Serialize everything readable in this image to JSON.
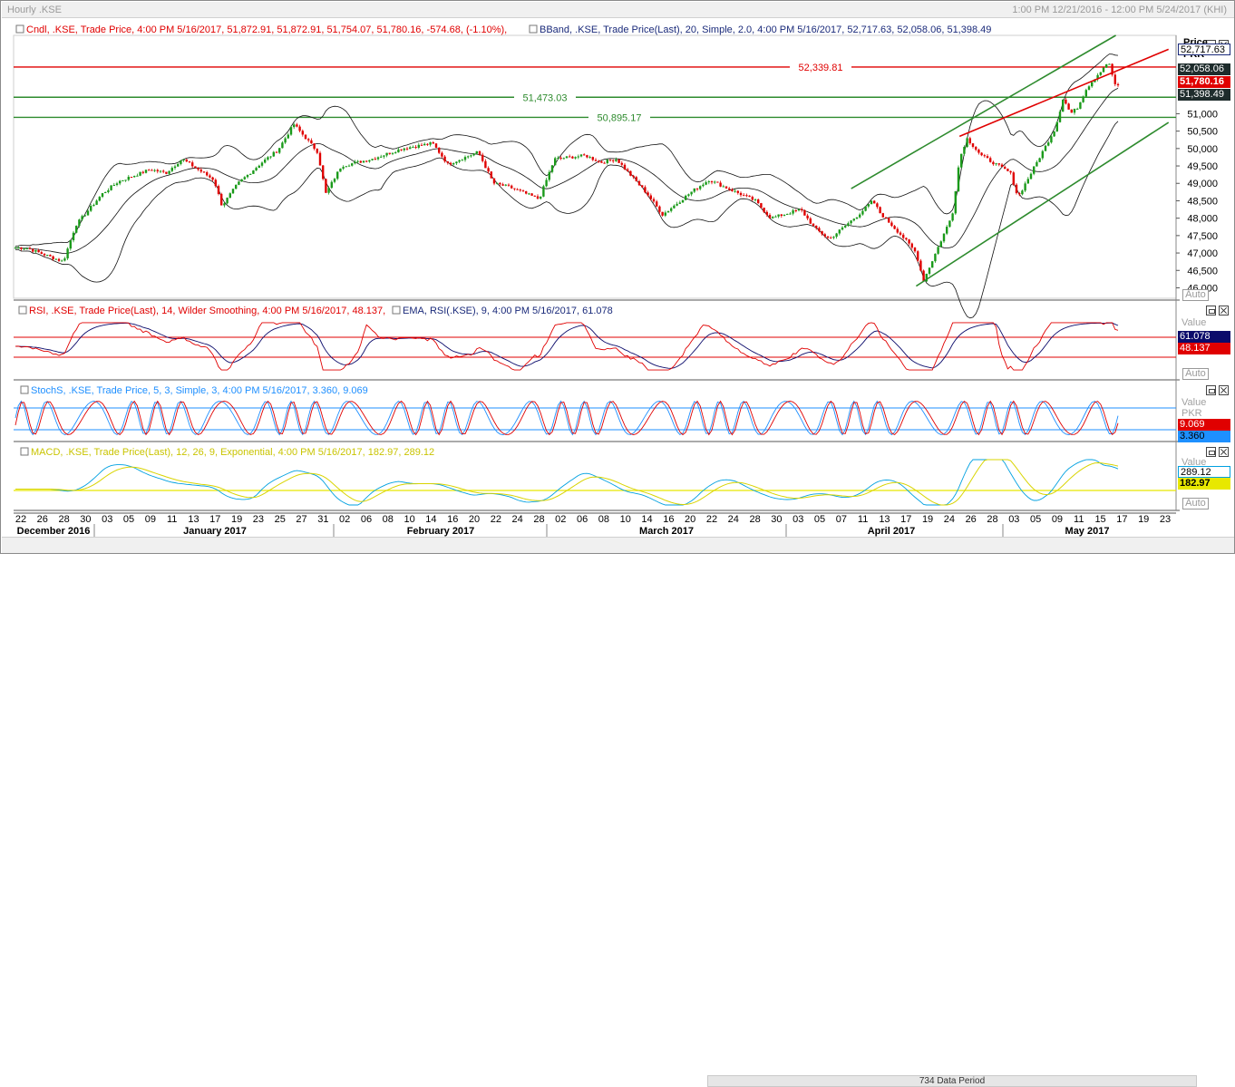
{
  "window": {
    "title": "Hourly .KSE",
    "range": "1:00 PM 12/21/2016 - 12:00 PM 5/24/2017 (KHI)"
  },
  "panes": {
    "price": {
      "legend_candle": "Cndl, .KSE, Trade Price, 4:00 PM 5/16/2017, 51,872.91, 51,872.91, 51,754.07, 51,780.16, -574.68, (-1.10%),",
      "legend_bband": "BBand, .KSE, Trade Price(Last), 20, Simple, 2.0, 4:00 PM 5/16/2017, 52,717.63, 52,058.06, 51,398.49",
      "axis_title": "Price",
      "axis_unit": "PKR",
      "tags": [
        "52,717.63",
        "52,058.06",
        "51,780.16",
        "51,398.49"
      ],
      "auto_label": "Auto"
    },
    "rsi": {
      "legend_rsi": "RSI, .KSE, Trade Price(Last), 14, Wilder Smoothing, 4:00 PM 5/16/2017, 48.137,",
      "legend_ema": "EMA, RSI(.KSE), 9, 4:00 PM 5/16/2017, 61.078",
      "axis_title": "Value",
      "tags": [
        "61.078",
        "48.137"
      ],
      "auto_label": "Auto"
    },
    "stoch": {
      "legend": "StochS, .KSE, Trade Price, 5, 3, Simple, 3, 4:00 PM 5/16/2017, 3.360, 9.069",
      "axis_title": "Value",
      "axis_unit": "PKR",
      "tags": [
        "9.069",
        "3.360"
      ]
    },
    "macd": {
      "legend": "MACD, .KSE, Trade Price(Last), 12, 26, 9, Exponential, 4:00 PM 5/16/2017, 182.97, 289.12",
      "axis_title": "Value",
      "tags": [
        "289.12",
        "182.97"
      ],
      "auto_label": "Auto"
    }
  },
  "statusbar": {
    "period": "734 Data Period"
  },
  "chart_data": {
    "type": "candlestick",
    "symbol": ".KSE",
    "interval": "Hourly",
    "y_ticks": [
      "46,000",
      "46,500",
      "47,000",
      "47,500",
      "48,000",
      "48,500",
      "49,000",
      "49,500",
      "50,000",
      "50,500",
      "51,000"
    ],
    "ylim": [
      45700,
      53250
    ],
    "horizontal_levels": [
      {
        "value": 52339.81,
        "label": "52,339.81",
        "color": "#e00000"
      },
      {
        "value": 51473.03,
        "label": "51,473.03",
        "color": "#2e8b2e"
      },
      {
        "value": 50895.17,
        "label": "50,895.17",
        "color": "#2e8b2e"
      }
    ],
    "x_day_ticks": [
      "22",
      "26",
      "28",
      "30",
      "03",
      "05",
      "09",
      "11",
      "13",
      "17",
      "19",
      "23",
      "25",
      "27",
      "31",
      "02",
      "06",
      "08",
      "10",
      "14",
      "16",
      "20",
      "22",
      "24",
      "28",
      "02",
      "06",
      "08",
      "10",
      "14",
      "16",
      "20",
      "22",
      "24",
      "28",
      "30",
      "03",
      "05",
      "07",
      "11",
      "13",
      "17",
      "19",
      "24",
      "26",
      "28",
      "03",
      "05",
      "09",
      "11",
      "15",
      "17",
      "19",
      "23"
    ],
    "x_month_labels": [
      "December 2016",
      "January 2017",
      "February 2017",
      "March 2017",
      "April 2017",
      "May 2017"
    ],
    "close_path": [
      [
        "12/22/2016",
        47150
      ],
      [
        "12/28/2016",
        46750
      ],
      [
        "12/30/2016",
        47800
      ],
      [
        "01/03/2017",
        48700
      ],
      [
        "01/05/2017",
        49050
      ],
      [
        "01/09/2017",
        49400
      ],
      [
        "01/11/2017",
        49300
      ],
      [
        "01/13/2017",
        49700
      ],
      [
        "01/17/2017",
        49100
      ],
      [
        "01/18/2017",
        48350
      ],
      [
        "01/20/2017",
        49000
      ],
      [
        "01/23/2017",
        49600
      ],
      [
        "01/25/2017",
        49950
      ],
      [
        "01/27/2017",
        50700
      ],
      [
        "01/30/2017",
        49900
      ],
      [
        "01/31/2017",
        48700
      ],
      [
        "02/02/2017",
        49500
      ],
      [
        "02/06/2017",
        49700
      ],
      [
        "02/08/2017",
        49850
      ],
      [
        "02/10/2017",
        50000
      ],
      [
        "02/14/2017",
        50150
      ],
      [
        "02/16/2017",
        49550
      ],
      [
        "02/20/2017",
        49900
      ],
      [
        "02/22/2017",
        49000
      ],
      [
        "02/24/2017",
        48900
      ],
      [
        "02/28/2017",
        48550
      ],
      [
        "03/02/2017",
        49700
      ],
      [
        "03/06/2017",
        49800
      ],
      [
        "03/08/2017",
        49600
      ],
      [
        "03/10/2017",
        49700
      ],
      [
        "03/14/2017",
        48700
      ],
      [
        "03/16/2017",
        48100
      ],
      [
        "03/20/2017",
        48800
      ],
      [
        "03/22/2017",
        49100
      ],
      [
        "03/24/2017",
        48900
      ],
      [
        "03/28/2017",
        48500
      ],
      [
        "03/30/2017",
        48000
      ],
      [
        "04/03/2017",
        48250
      ],
      [
        "04/05/2017",
        47700
      ],
      [
        "04/07/2017",
        47400
      ],
      [
        "04/11/2017",
        48100
      ],
      [
        "04/13/2017",
        48500
      ],
      [
        "04/14/2017",
        48150
      ],
      [
        "04/17/2017",
        47500
      ],
      [
        "04/19/2017",
        47000
      ],
      [
        "04/20/2017",
        46200
      ],
      [
        "04/24/2017",
        48100
      ],
      [
        "04/25/2017",
        49700
      ],
      [
        "04/26/2017",
        50300
      ],
      [
        "04/28/2017",
        49800
      ],
      [
        "05/02/2017",
        49300
      ],
      [
        "05/03/2017",
        48600
      ],
      [
        "05/05/2017",
        49400
      ],
      [
        "05/08/2017",
        50600
      ],
      [
        "05/09/2017",
        51450
      ],
      [
        "05/10/2017",
        51000
      ],
      [
        "05/11/2017",
        51200
      ],
      [
        "05/12/2017",
        51700
      ],
      [
        "05/15/2017",
        52500
      ],
      [
        "05/16/2017",
        51780
      ]
    ]
  }
}
